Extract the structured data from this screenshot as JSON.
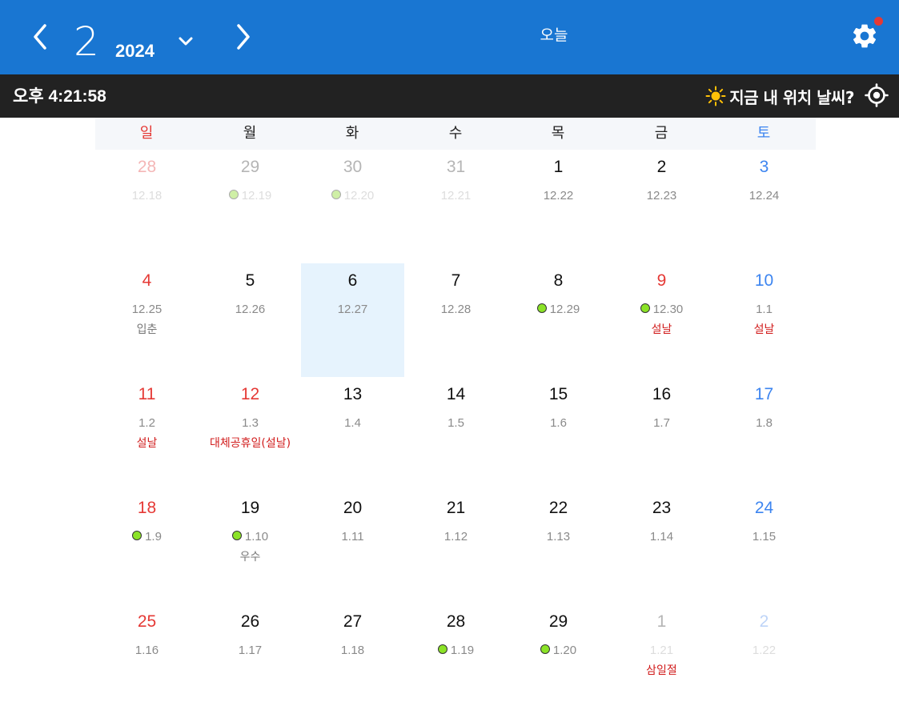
{
  "header": {
    "month": "2",
    "year": "2024",
    "today_label": "오늘",
    "prev_icon": "chevron-left-icon",
    "next_icon": "chevron-right-icon",
    "settings_icon": "gear-icon",
    "badge_color": "#e53935",
    "accent_color": "#1976d2"
  },
  "status": {
    "time": "오후 4:21:58",
    "weather_prompt": "지금 내 위치 날씨?",
    "weather_icon": "sun-icon",
    "locate_icon": "crosshair-icon"
  },
  "weekdays": [
    "일",
    "월",
    "화",
    "수",
    "목",
    "금",
    "토"
  ],
  "weeks": [
    [
      {
        "day": "28",
        "lunar": "12.18",
        "other": true
      },
      {
        "day": "29",
        "lunar": "12.19",
        "other": true,
        "dot": true
      },
      {
        "day": "30",
        "lunar": "12.20",
        "other": true,
        "dot": true
      },
      {
        "day": "31",
        "lunar": "12.21",
        "other": true
      },
      {
        "day": "1",
        "lunar": "12.22"
      },
      {
        "day": "2",
        "lunar": "12.23"
      },
      {
        "day": "3",
        "lunar": "12.24"
      }
    ],
    [
      {
        "day": "4",
        "lunar": "12.25",
        "note": "입춘"
      },
      {
        "day": "5",
        "lunar": "12.26"
      },
      {
        "day": "6",
        "lunar": "12.27",
        "selected": true
      },
      {
        "day": "7",
        "lunar": "12.28"
      },
      {
        "day": "8",
        "lunar": "12.29",
        "dot": true
      },
      {
        "day": "9",
        "lunar": "12.30",
        "dot": true,
        "note": "설날",
        "holiday": true
      },
      {
        "day": "10",
        "lunar": "1.1",
        "note": "설날",
        "holiday": true
      }
    ],
    [
      {
        "day": "11",
        "lunar": "1.2",
        "note": "설날",
        "holiday": true
      },
      {
        "day": "12",
        "lunar": "1.3",
        "note": "대체공휴일(설날)",
        "holiday": true
      },
      {
        "day": "13",
        "lunar": "1.4"
      },
      {
        "day": "14",
        "lunar": "1.5"
      },
      {
        "day": "15",
        "lunar": "1.6"
      },
      {
        "day": "16",
        "lunar": "1.7"
      },
      {
        "day": "17",
        "lunar": "1.8"
      }
    ],
    [
      {
        "day": "18",
        "lunar": "1.9",
        "dot": true
      },
      {
        "day": "19",
        "lunar": "1.10",
        "dot": true,
        "note": "우수"
      },
      {
        "day": "20",
        "lunar": "1.11"
      },
      {
        "day": "21",
        "lunar": "1.12"
      },
      {
        "day": "22",
        "lunar": "1.13"
      },
      {
        "day": "23",
        "lunar": "1.14"
      },
      {
        "day": "24",
        "lunar": "1.15"
      }
    ],
    [
      {
        "day": "25",
        "lunar": "1.16"
      },
      {
        "day": "26",
        "lunar": "1.17"
      },
      {
        "day": "27",
        "lunar": "1.18"
      },
      {
        "day": "28",
        "lunar": "1.19",
        "dot": true
      },
      {
        "day": "29",
        "lunar": "1.20",
        "dot": true
      },
      {
        "day": "1",
        "lunar": "1.21",
        "other": true,
        "note": "삼일절",
        "holiday": true
      },
      {
        "day": "2",
        "lunar": "1.22",
        "other": true
      }
    ]
  ]
}
